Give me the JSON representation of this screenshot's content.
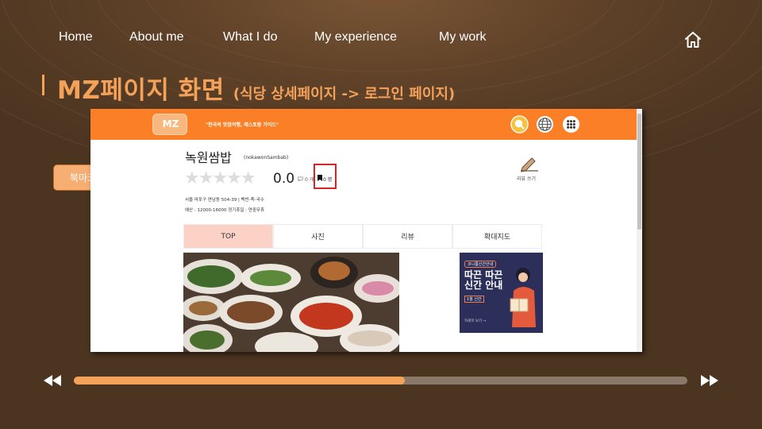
{
  "nav": {
    "items": [
      {
        "label": "Home"
      },
      {
        "label": "About me"
      },
      {
        "label": "What I do"
      },
      {
        "label": "My experience"
      },
      {
        "label": "My work"
      }
    ],
    "home_icon": "home-icon"
  },
  "title": {
    "main": "MZ페이지 화면",
    "sub": "(식당 상세페이지 -> 로그인 페이지)"
  },
  "annotation": {
    "bookmark_label": "북마크 구현"
  },
  "screenshot": {
    "logo": "MZ",
    "slogan": "\"한국의 맛집여행, 레스토랑 가이드\"",
    "header_icons": [
      "user-icon",
      "globe-icon",
      "grid-icon"
    ],
    "restaurant": {
      "name": "녹원쌈밥",
      "name_en": "(nokawonSambab)",
      "rating": "0.0",
      "review_count": "0 개",
      "bookmark_count": "0 명",
      "address": "서울 마포구 연남동 504-39 |   백반-죽-국수",
      "budget": "예산 : 12000-16000    정기휴일 : 연중무휴"
    },
    "write_review": "리뷰 쓰기",
    "tabs": [
      {
        "label": "TOP"
      },
      {
        "label": "사진"
      },
      {
        "label": "리뷰"
      },
      {
        "label": "확대지도"
      }
    ],
    "ad": {
      "badge": "코니름신간안내",
      "title": "따끈 따끈 신간 안내",
      "sub": "1월  신간",
      "foot": "자세히 보기 →"
    }
  },
  "player": {
    "progress": 0.54,
    "prev_icon": "rewind-icon",
    "next_icon": "fast-forward-icon"
  },
  "colors": {
    "accent": "#f4a25a",
    "header_orange": "#fa7f27",
    "background": "#5e4128"
  }
}
